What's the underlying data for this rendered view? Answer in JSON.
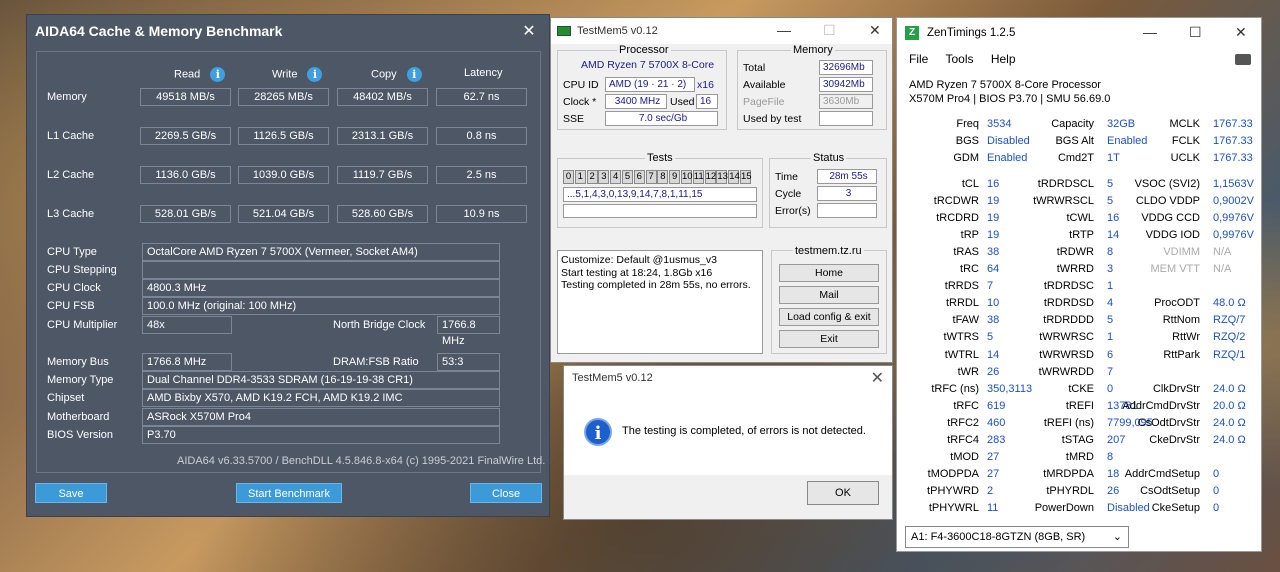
{
  "aida": {
    "title": "AIDA64 Cache & Memory Benchmark",
    "close": "✕",
    "headers": {
      "read": "Read",
      "write": "Write",
      "copy": "Copy",
      "latency": "Latency"
    },
    "rows": [
      {
        "label": "Memory",
        "read": "49518 MB/s",
        "write": "28265 MB/s",
        "copy": "48402 MB/s",
        "latency": "62.7 ns"
      },
      {
        "label": "L1 Cache",
        "read": "2269.5 GB/s",
        "write": "1126.5 GB/s",
        "copy": "2313.1 GB/s",
        "latency": "0.8 ns"
      },
      {
        "label": "L2 Cache",
        "read": "1136.0 GB/s",
        "write": "1039.0 GB/s",
        "copy": "1119.7 GB/s",
        "latency": "2.5 ns"
      },
      {
        "label": "L3 Cache",
        "read": "528.01 GB/s",
        "write": "521.04 GB/s",
        "copy": "528.60 GB/s",
        "latency": "10.9 ns"
      }
    ],
    "cpu_type_l": "CPU Type",
    "cpu_type": "OctalCore AMD Ryzen 7 5700X  (Vermeer, Socket AM4)",
    "cpu_stepping_l": "CPU Stepping",
    "cpu_stepping": "",
    "cpu_clock_l": "CPU Clock",
    "cpu_clock": "4800.3 MHz",
    "cpu_fsb_l": "CPU FSB",
    "cpu_fsb": "100.0 MHz  (original: 100 MHz)",
    "cpu_mult_l": "CPU Multiplier",
    "cpu_mult": "48x",
    "nb_clock_l": "North Bridge Clock",
    "nb_clock": "1766.8 MHz",
    "mem_bus_l": "Memory Bus",
    "mem_bus": "1766.8 MHz",
    "dram_ratio_l": "DRAM:FSB Ratio",
    "dram_ratio": "53:3",
    "mem_type_l": "Memory Type",
    "mem_type": "Dual Channel DDR4-3533 SDRAM  (16-19-19-38 CR1)",
    "chipset_l": "Chipset",
    "chipset": "AMD Bixby X570, AMD K19.2 FCH, AMD K19.2 IMC",
    "mobo_l": "Motherboard",
    "mobo": "ASRock X570M Pro4",
    "bios_l": "BIOS Version",
    "bios": "P3.70",
    "copyright": "AIDA64 v6.33.5700 / BenchDLL 4.5.846.8-x64  (c) 1995-2021 FinalWire Ltd.",
    "save": "Save",
    "start": "Start Benchmark",
    "close_btn": "Close"
  },
  "tm": {
    "title": "TestMem5 v0.12",
    "processor_t": "Processor",
    "cpu_name": "AMD Ryzen 7 5700X 8-Core",
    "cpuid_l": "CPU ID",
    "cpuid": "AMD  (19 · 21 · 2)",
    "cpuid_x": "x16",
    "clock_l": "Clock *",
    "clock": "3400 MHz",
    "used_l": "Used",
    "used": "16",
    "sse_l": "SSE",
    "sse": "7.0 sec/Gb",
    "memory_t": "Memory",
    "total_l": "Total",
    "total": "32696Mb",
    "avail_l": "Available",
    "avail": "30942Mb",
    "pagefile_l": "PageFile",
    "pagefile": "3630Mb",
    "usedtest_l": "Used by test",
    "usedtest": "",
    "tests_t": "Tests",
    "tests": [
      "0",
      "1",
      "2",
      "3",
      "4",
      "5",
      "6",
      "7",
      "8",
      "9",
      "10",
      "11",
      "12",
      "13",
      "14",
      "15"
    ],
    "sequence": "...5,1,4,3,0,13,9,14,7,8,1,11,15",
    "status_t": "Status",
    "time_l": "Time",
    "time": "28m 55s",
    "cycle_l": "Cycle",
    "cycle": "3",
    "errors_l": "Error(s)",
    "errors": "",
    "log": [
      "Customize: Default @1usmus_v3",
      "Start testing at 18:24, 1.8Gb x16",
      "Testing completed in 28m 55s, no errors."
    ],
    "site": "testmem.tz.ru",
    "home": "Home",
    "mail": "Mail",
    "load": "Load config & exit",
    "exit": "Exit"
  },
  "dlg": {
    "title": "TestMem5 v0.12",
    "msg": "The testing is completed, of errors is not detected.",
    "ok": "OK",
    "icon": "i"
  },
  "zt": {
    "title": "ZenTimings 1.2.5",
    "menu": {
      "file": "File",
      "tools": "Tools",
      "help": "Help"
    },
    "cpu": "AMD Ryzen 7 5700X 8-Core Processor",
    "board": "X570M Pro4 | BIOS P3.70 | SMU 56.69.0",
    "col1": [
      [
        "Freq",
        "3534"
      ],
      [
        "BGS",
        "Disabled"
      ],
      [
        "GDM",
        "Enabled"
      ],
      [
        "",
        ""
      ],
      [
        "tCL",
        "16"
      ],
      [
        "tRCDWR",
        "19"
      ],
      [
        "tRCDRD",
        "19"
      ],
      [
        "tRP",
        "19"
      ],
      [
        "tRAS",
        "38"
      ],
      [
        "tRC",
        "64"
      ],
      [
        "tRRDS",
        "7"
      ],
      [
        "tRRDL",
        "10"
      ],
      [
        "tFAW",
        "38"
      ],
      [
        "tWTRS",
        "5"
      ],
      [
        "tWTRL",
        "14"
      ],
      [
        "tWR",
        "26"
      ],
      [
        "tRFC (ns)",
        "350,3113"
      ],
      [
        "tRFC",
        "619"
      ],
      [
        "tRFC2",
        "460"
      ],
      [
        "tRFC4",
        "283"
      ],
      [
        "tMOD",
        "27"
      ],
      [
        "tMODPDA",
        "27"
      ],
      [
        "tPHYWRD",
        "2"
      ],
      [
        "tPHYWRL",
        "11"
      ]
    ],
    "col2": [
      [
        "Capacity",
        "32GB"
      ],
      [
        "BGS Alt",
        "Enabled"
      ],
      [
        "Cmd2T",
        "1T"
      ],
      [
        "",
        ""
      ],
      [
        "tRDRDSCL",
        "5"
      ],
      [
        "tWRWRSCL",
        "5"
      ],
      [
        "tCWL",
        "16"
      ],
      [
        "tRTP",
        "14"
      ],
      [
        "tRDWR",
        "8"
      ],
      [
        "tWRRD",
        "3"
      ],
      [
        "tRDRDSC",
        "1"
      ],
      [
        "tRDRDSD",
        "4"
      ],
      [
        "tRDRDDD",
        "5"
      ],
      [
        "tWRWRSC",
        "1"
      ],
      [
        "tWRWRSD",
        "6"
      ],
      [
        "tWRWRDD",
        "7"
      ],
      [
        "tCKE",
        "0"
      ],
      [
        "tREFI",
        "13781"
      ],
      [
        "tREFI (ns)",
        "7799,095"
      ],
      [
        "tSTAG",
        "207"
      ],
      [
        "tMRD",
        "8"
      ],
      [
        "tMRDPDA",
        "18"
      ],
      [
        "tPHYRDL",
        "26"
      ],
      [
        "PowerDown",
        "Disabled"
      ]
    ],
    "col3": [
      [
        "MCLK",
        "1767.33"
      ],
      [
        "FCLK",
        "1767.33"
      ],
      [
        "UCLK",
        "1767.33"
      ],
      [
        "",
        ""
      ],
      [
        "VSOC (SVI2)",
        "1,1563V"
      ],
      [
        "CLDO VDDP",
        "0,9002V"
      ],
      [
        "VDDG CCD",
        "0,9976V"
      ],
      [
        "VDDG IOD",
        "0,9976V"
      ],
      [
        "VDIMM",
        "N/A"
      ],
      [
        "MEM VTT",
        "N/A"
      ],
      [
        "",
        ""
      ],
      [
        "ProcODT",
        "48.0 Ω"
      ],
      [
        "RttNom",
        "RZQ/7"
      ],
      [
        "RttWr",
        "RZQ/2"
      ],
      [
        "RttPark",
        "RZQ/1"
      ],
      [
        "",
        ""
      ],
      [
        "ClkDrvStr",
        "24.0 Ω"
      ],
      [
        "AddrCmdDrvStr",
        "20.0 Ω"
      ],
      [
        "CsOdtDrvStr",
        "24.0 Ω"
      ],
      [
        "CkeDrvStr",
        "24.0 Ω"
      ],
      [
        "",
        ""
      ],
      [
        "AddrCmdSetup",
        "0"
      ],
      [
        "CsOdtSetup",
        "0"
      ],
      [
        "CkeSetup",
        "0"
      ]
    ],
    "dimm": "A1: F4-3600C18-8GTZN (8GB, SR)"
  }
}
